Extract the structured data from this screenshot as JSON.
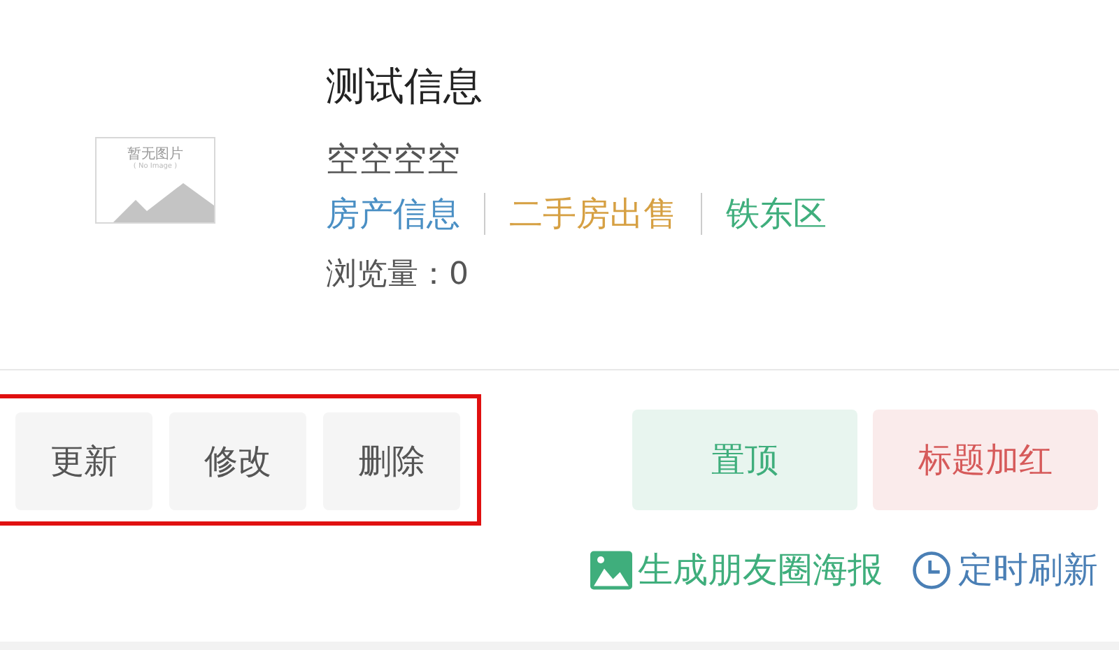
{
  "listing": {
    "thumbnail": {
      "caption": "暂无图片",
      "subcaption": "( No Image )"
    },
    "title": "测试信息",
    "description": "空空空空",
    "tags": [
      {
        "label": "房产信息",
        "color": "#4a8fc4"
      },
      {
        "label": "二手房出售",
        "color": "#d6a043"
      },
      {
        "label": "铁东区",
        "color": "#3fae7c"
      }
    ],
    "views": "浏览量：0"
  },
  "manage_actions": {
    "highlighted": true,
    "buttons": [
      {
        "label": "更新"
      },
      {
        "label": "修改"
      },
      {
        "label": "删除"
      }
    ]
  },
  "promote_actions": [
    {
      "label": "置顶",
      "color": "#3fae7c"
    },
    {
      "label": "标题加红",
      "color": "#d65a5a"
    }
  ],
  "links": [
    {
      "kind": "poster",
      "label": "生成朋友圈海报"
    },
    {
      "kind": "timer",
      "label": "定时刷新"
    }
  ]
}
